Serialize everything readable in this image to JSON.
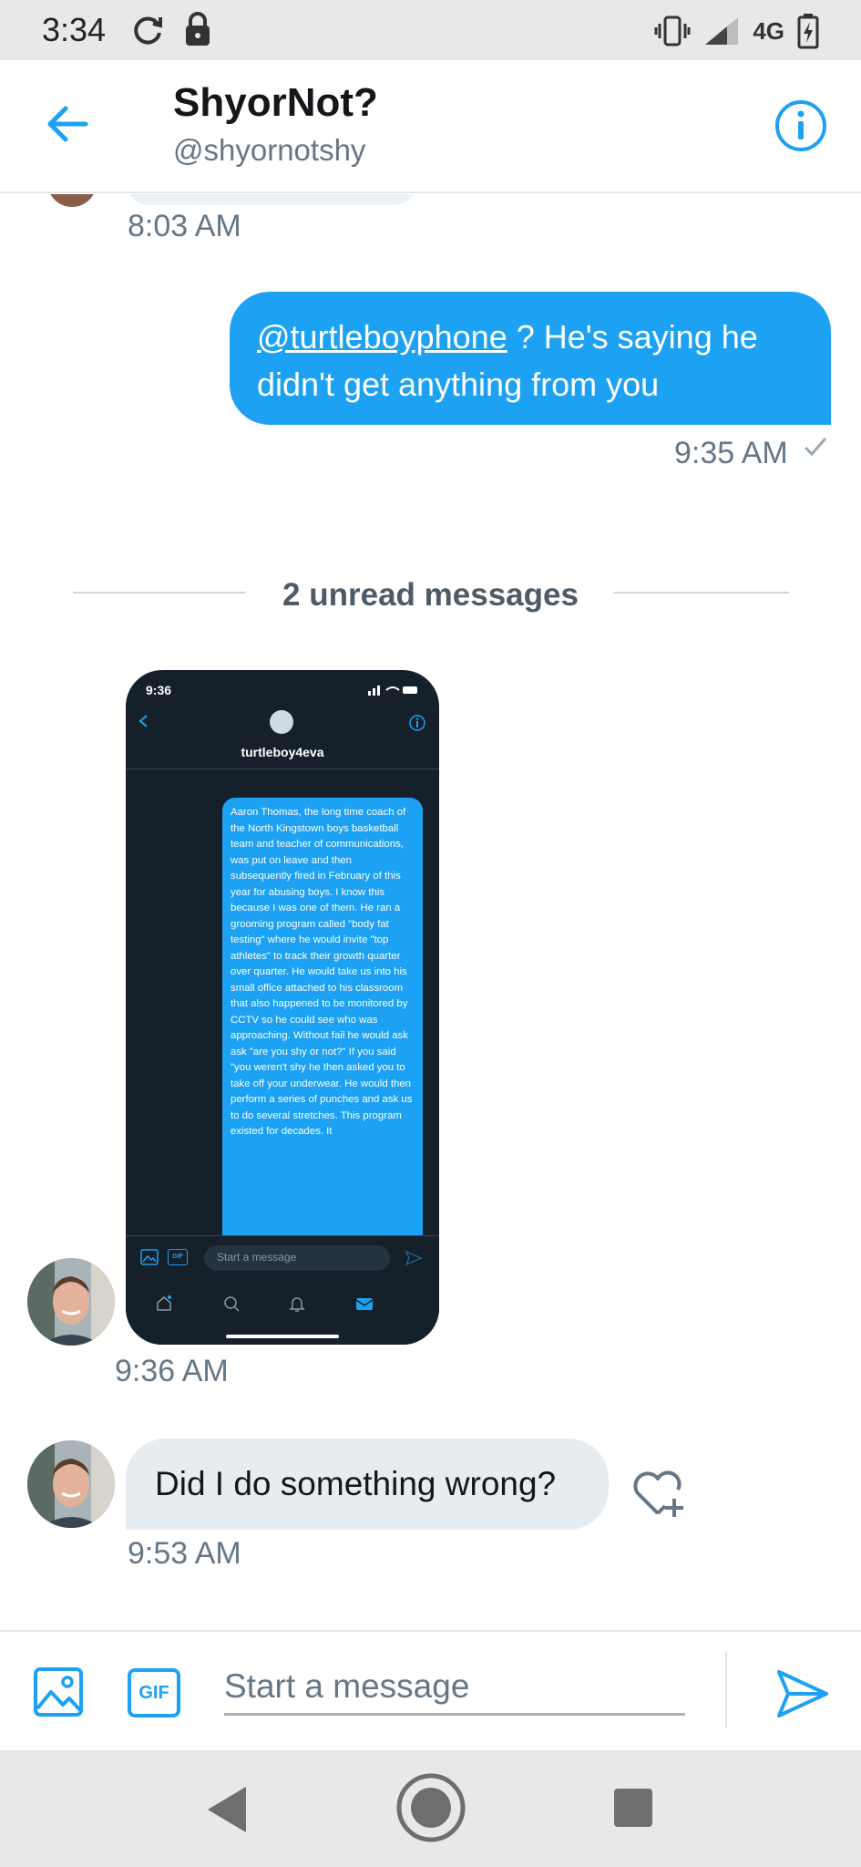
{
  "status_bar": {
    "time": "3:34",
    "network": "4G",
    "icons": [
      "sync-icon",
      "lock-icon",
      "vibrate-icon",
      "signal-icon",
      "battery-charging-icon"
    ]
  },
  "header": {
    "name": "ShyorNot?",
    "handle": "@shyornotshy",
    "back_icon": "back-arrow-icon",
    "info_icon": "info-icon"
  },
  "colors": {
    "accent": "#1da1f2",
    "incoming_bubble": "#e6ecf0",
    "secondary_text": "#657786",
    "embedded_background": "#15202b"
  },
  "messages": {
    "earlier_timestamp": "8:03 AM",
    "outgoing": {
      "mention": "@turtleboyphone",
      "text": " ? He's saying he didn't get anything from you",
      "timestamp": "9:35 AM",
      "status_icon": "sent-check-icon"
    },
    "unread_divider": "2 unread messages",
    "incoming_image": {
      "timestamp": "9:36 AM",
      "screenshot": {
        "time": "9:36",
        "title": "turtleboy4eva",
        "body": "Aaron Thomas, the long time coach of the North Kingstown boys basketball team and teacher of communications, was put on leave and then subsequently fired in February of this year for abusing boys. I know this because I was one of them. He ran a grooming program called \"body fat testing\" where he would invite \"top athletes\" to track their growth quarter over quarter. He would take us into his small office attached to his classroom that also happened to be monitored by CCTV so he could see who was approaching. Without fail he would ask ask \"are you shy or not?\" If you said \"you weren't shy he then asked you to take off your underwear. He would then perform a series of punches and ask us to do several stretches. This program existed for decades. It",
        "composer_placeholder": "Start a message",
        "gif_label": "GIF"
      }
    },
    "incoming_text": {
      "text": "Did I do something wrong?",
      "timestamp": "9:53 AM",
      "reaction_icon": "add-reaction-heart-icon"
    }
  },
  "composer": {
    "placeholder": "Start a message",
    "gif_label": "GIF",
    "image_icon": "image-icon",
    "send_icon": "send-icon"
  },
  "nav_bar": {
    "icons": [
      "nav-back-icon",
      "nav-home-icon",
      "nav-recents-icon"
    ]
  }
}
